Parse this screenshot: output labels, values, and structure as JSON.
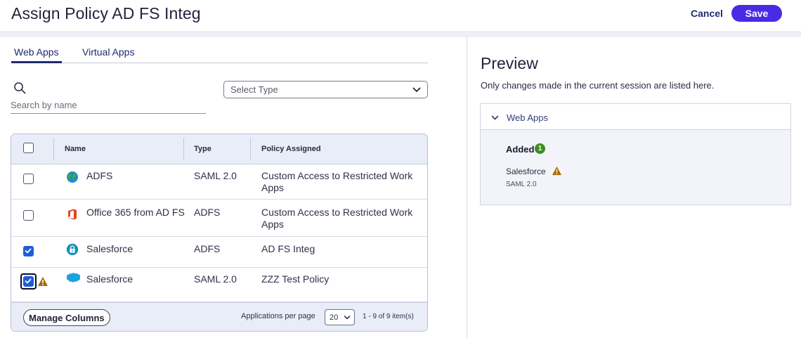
{
  "header": {
    "title": "Assign Policy AD FS Integ",
    "cancel_label": "Cancel",
    "save_label": "Save"
  },
  "tabs": [
    {
      "label": "Web Apps",
      "active": true
    },
    {
      "label": "Virtual Apps",
      "active": false
    }
  ],
  "search": {
    "placeholder": "Search by name",
    "value": ""
  },
  "type_filter": {
    "placeholder": "Select Type"
  },
  "table": {
    "columns": [
      "Name",
      "Type",
      "Policy Assigned"
    ],
    "rows": [
      {
        "name": "ADFS",
        "type": "SAML 2.0",
        "policy": "Custom Access to Restricted Work Apps",
        "checked": false,
        "icon": "adfs-globe-icon",
        "warning": false
      },
      {
        "name": "Office 365 from AD FS",
        "type": "ADFS",
        "policy": "Custom Access to Restricted Work Apps",
        "checked": false,
        "icon": "office-365-icon",
        "warning": false
      },
      {
        "name": "Salesforce",
        "type": "ADFS",
        "policy": "AD FS Integ",
        "checked": true,
        "icon": "lock-app-icon",
        "warning": false
      },
      {
        "name": "Salesforce",
        "type": "SAML 2.0",
        "policy": "ZZZ Test Policy",
        "checked": true,
        "icon": "salesforce-cloud-icon",
        "warning": true
      }
    ]
  },
  "footer": {
    "manage_columns_label": "Manage Columns",
    "per_page_label": "Applications per page",
    "per_page_value": "20",
    "page_count": "1 - 9 of 9 item(s)"
  },
  "preview": {
    "title": "Preview",
    "subtitle": "Only changes made in the current session are listed here.",
    "section_label": "Web Apps",
    "added_label": "Added",
    "added_count": "1",
    "items": [
      {
        "name": "Salesforce",
        "type": "SAML 2.0",
        "warning": true
      }
    ]
  },
  "colors": {
    "primary": "#4b2ae6",
    "checkbox": "#1d5ed8",
    "warning": "#a66a00",
    "success": "#3a8e1d"
  }
}
